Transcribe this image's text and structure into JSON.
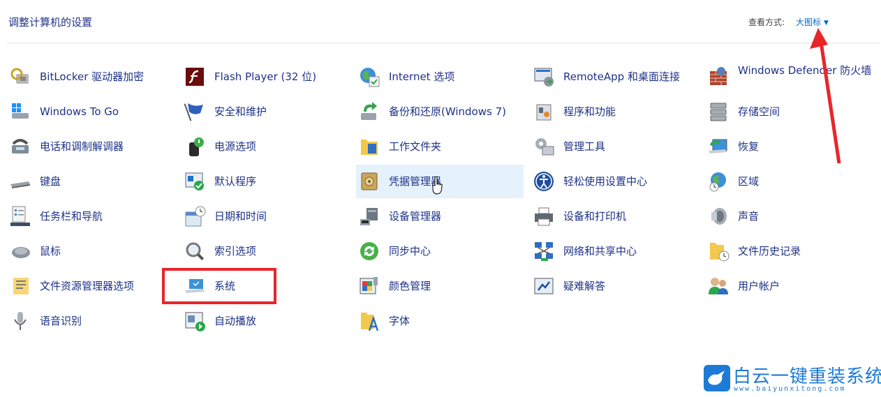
{
  "header": {
    "title": "调整计算机的设置",
    "view_label": "查看方式:",
    "view_value": "大图标"
  },
  "items": [
    {
      "label": "BitLocker 驱动器加密",
      "icon": "bitlocker-icon"
    },
    {
      "label": "Windows To Go",
      "icon": "windows-to-go-icon"
    },
    {
      "label": "电话和调制解调器",
      "icon": "phone-modem-icon"
    },
    {
      "label": "键盘",
      "icon": "keyboard-icon"
    },
    {
      "label": "任务栏和导航",
      "icon": "taskbar-icon"
    },
    {
      "label": "鼠标",
      "icon": "mouse-icon"
    },
    {
      "label": "文件资源管理器选项",
      "icon": "folder-options-icon"
    },
    {
      "label": "语音识别",
      "icon": "microphone-icon"
    },
    {
      "label": "Flash Player (32 位)",
      "icon": "flash-icon"
    },
    {
      "label": "安全和维护",
      "icon": "flag-icon"
    },
    {
      "label": "电源选项",
      "icon": "power-icon"
    },
    {
      "label": "默认程序",
      "icon": "default-programs-icon"
    },
    {
      "label": "日期和时间",
      "icon": "calendar-clock-icon"
    },
    {
      "label": "索引选项",
      "icon": "magnifier-icon"
    },
    {
      "label": "系统",
      "icon": "laptop-icon"
    },
    {
      "label": "自动播放",
      "icon": "autoplay-icon"
    },
    {
      "label": "Internet 选项",
      "icon": "globe-icon"
    },
    {
      "label": "备份和还原(Windows 7)",
      "icon": "backup-icon"
    },
    {
      "label": "工作文件夹",
      "icon": "work-folders-icon"
    },
    {
      "label": "凭据管理器",
      "icon": "vault-icon"
    },
    {
      "label": "设备管理器",
      "icon": "device-manager-icon"
    },
    {
      "label": "同步中心",
      "icon": "sync-icon"
    },
    {
      "label": "颜色管理",
      "icon": "color-icon"
    },
    {
      "label": "字体",
      "icon": "font-folder-icon"
    },
    {
      "label": "RemoteApp 和桌面连接",
      "icon": "remoteapp-icon"
    },
    {
      "label": "程序和功能",
      "icon": "programs-icon"
    },
    {
      "label": "管理工具",
      "icon": "admin-tools-icon"
    },
    {
      "label": "轻松使用设置中心",
      "icon": "ease-of-access-icon"
    },
    {
      "label": "设备和打印机",
      "icon": "printer-icon"
    },
    {
      "label": "网络和共享中心",
      "icon": "network-icon"
    },
    {
      "label": "疑难解答",
      "icon": "troubleshoot-icon"
    },
    {
      "label": "Windows Defender 防火墙",
      "icon": "firewall-icon"
    },
    {
      "label": "存储空间",
      "icon": "storage-icon"
    },
    {
      "label": "恢复",
      "icon": "recovery-icon"
    },
    {
      "label": "区域",
      "icon": "region-icon"
    },
    {
      "label": "声音",
      "icon": "speaker-icon"
    },
    {
      "label": "文件历史记录",
      "icon": "file-history-icon"
    },
    {
      "label": "用户帐户",
      "icon": "users-icon"
    }
  ],
  "watermark": {
    "title": "白云一键重装系统",
    "url": "www.baiyunxitong.com"
  },
  "colors": {
    "link": "#1e3287",
    "accent": "#0066cc",
    "highlight": "#e8262a",
    "hover": "#e5f1fb"
  }
}
